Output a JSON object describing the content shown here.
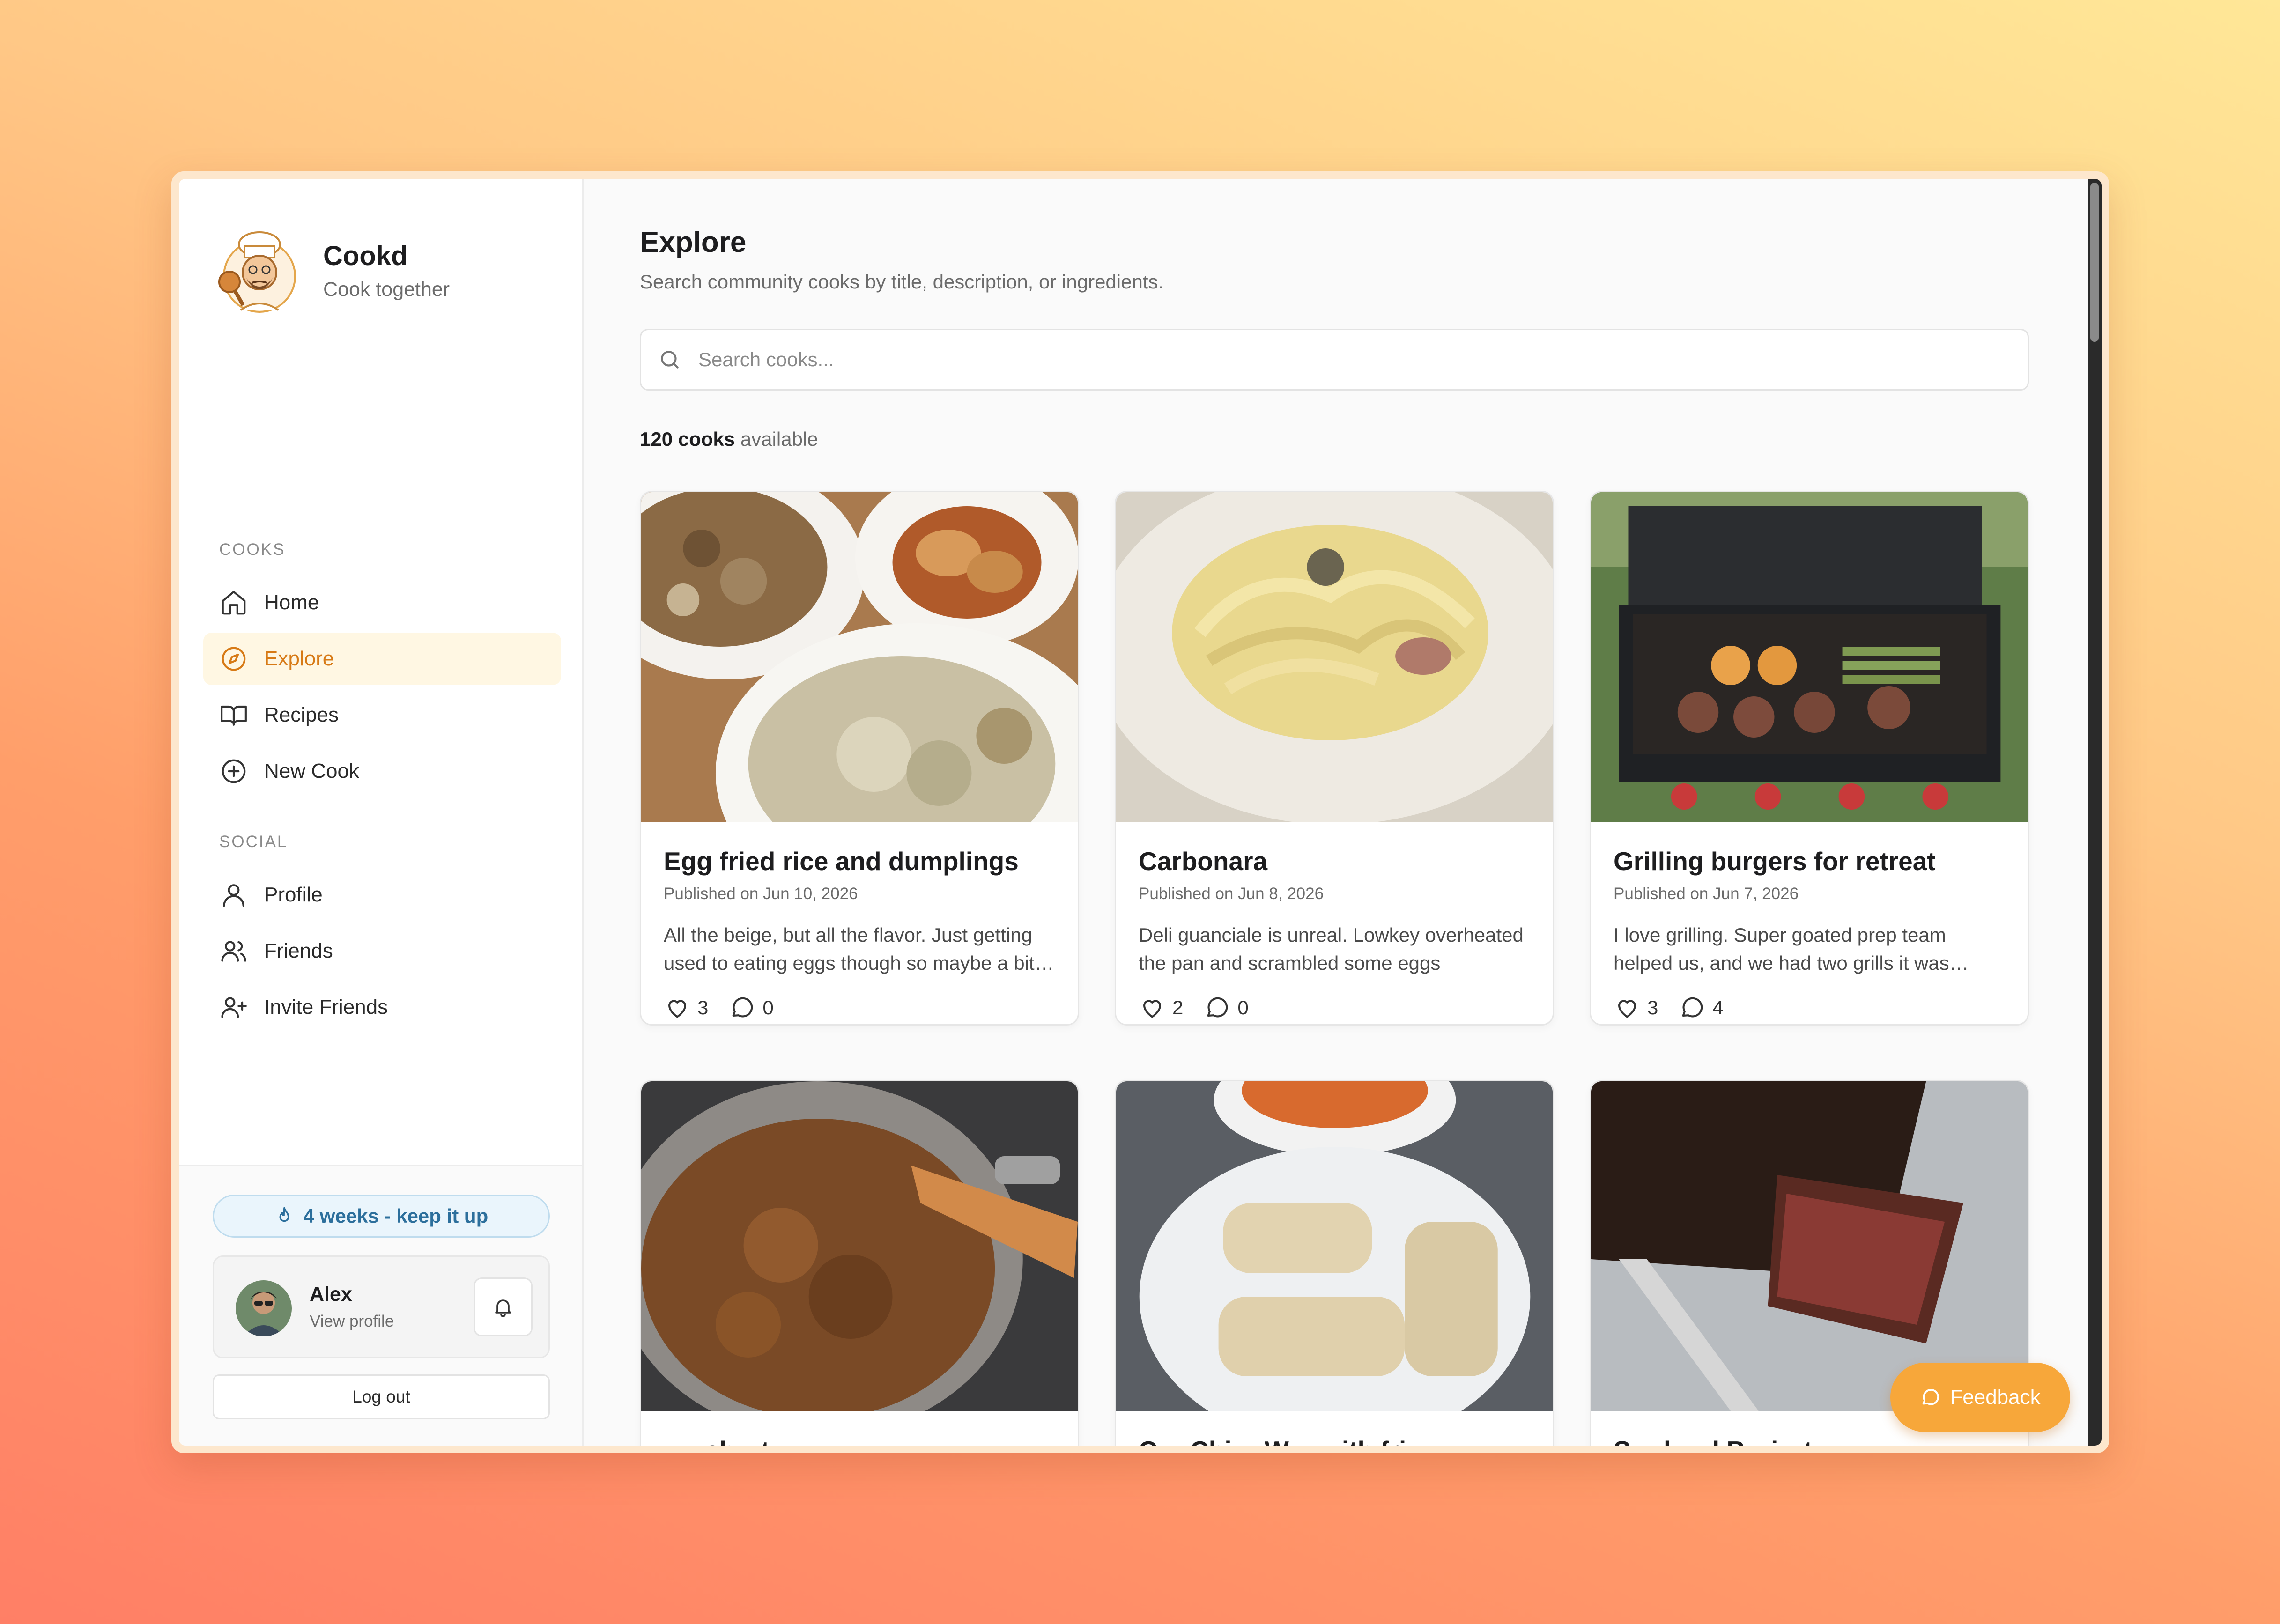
{
  "app": {
    "name": "Cookd",
    "tagline": "Cook together"
  },
  "sidebar": {
    "sections": {
      "cooks": "COOKS",
      "social": "SOCIAL"
    },
    "items": [
      {
        "label": "Home",
        "icon": "home-icon"
      },
      {
        "label": "Explore",
        "icon": "compass-icon",
        "active": true
      },
      {
        "label": "Recipes",
        "icon": "book-icon"
      },
      {
        "label": "New Cook",
        "icon": "plus-circle-icon"
      },
      {
        "label": "Profile",
        "icon": "user-icon"
      },
      {
        "label": "Friends",
        "icon": "users-icon"
      },
      {
        "label": "Invite Friends",
        "icon": "user-plus-icon"
      }
    ],
    "streak": "4 weeks - keep it up",
    "user": {
      "name": "Alex",
      "subtitle": "View profile"
    },
    "logout_label": "Log out"
  },
  "main": {
    "title": "Explore",
    "subtitle": "Search community cooks by title, description, or ingredients.",
    "search": {
      "placeholder": "Search cooks..."
    },
    "count": {
      "number": "120 cooks",
      "suffix": "available"
    },
    "cards": [
      {
        "title": "Egg fried rice and dumplings",
        "date": "Published on Jun 10, 2026",
        "description": "All the beige, but all the flavor. Just getting used to eating eggs though so maybe a bit…",
        "likes": "3",
        "comments": "0"
      },
      {
        "title": "Carbonara",
        "date": "Published on Jun 8, 2026",
        "description": "Deli guanciale is unreal. Lowkey overheated the pan and scrambled some eggs",
        "likes": "2",
        "comments": "0"
      },
      {
        "title": "Grilling burgers for retreat",
        "date": "Published on Jun 7, 2026",
        "description": "I love grilling. Super goated prep team helped us, and we had two grills it was…",
        "likes": "3",
        "comments": "4"
      },
      {
        "title": "…ush…t…"
      },
      {
        "title": "C… Chi… W… with fri…"
      },
      {
        "title": "S… k…d B…i…t"
      }
    ],
    "feedback_label": "Feedback"
  },
  "colors": {
    "accent": "#d77a16",
    "active_bg": "#fff7e3",
    "streak_text": "#2c6f9c",
    "streak_bg": "#eaf5fc",
    "feedback_bg": "#f7a73a"
  }
}
